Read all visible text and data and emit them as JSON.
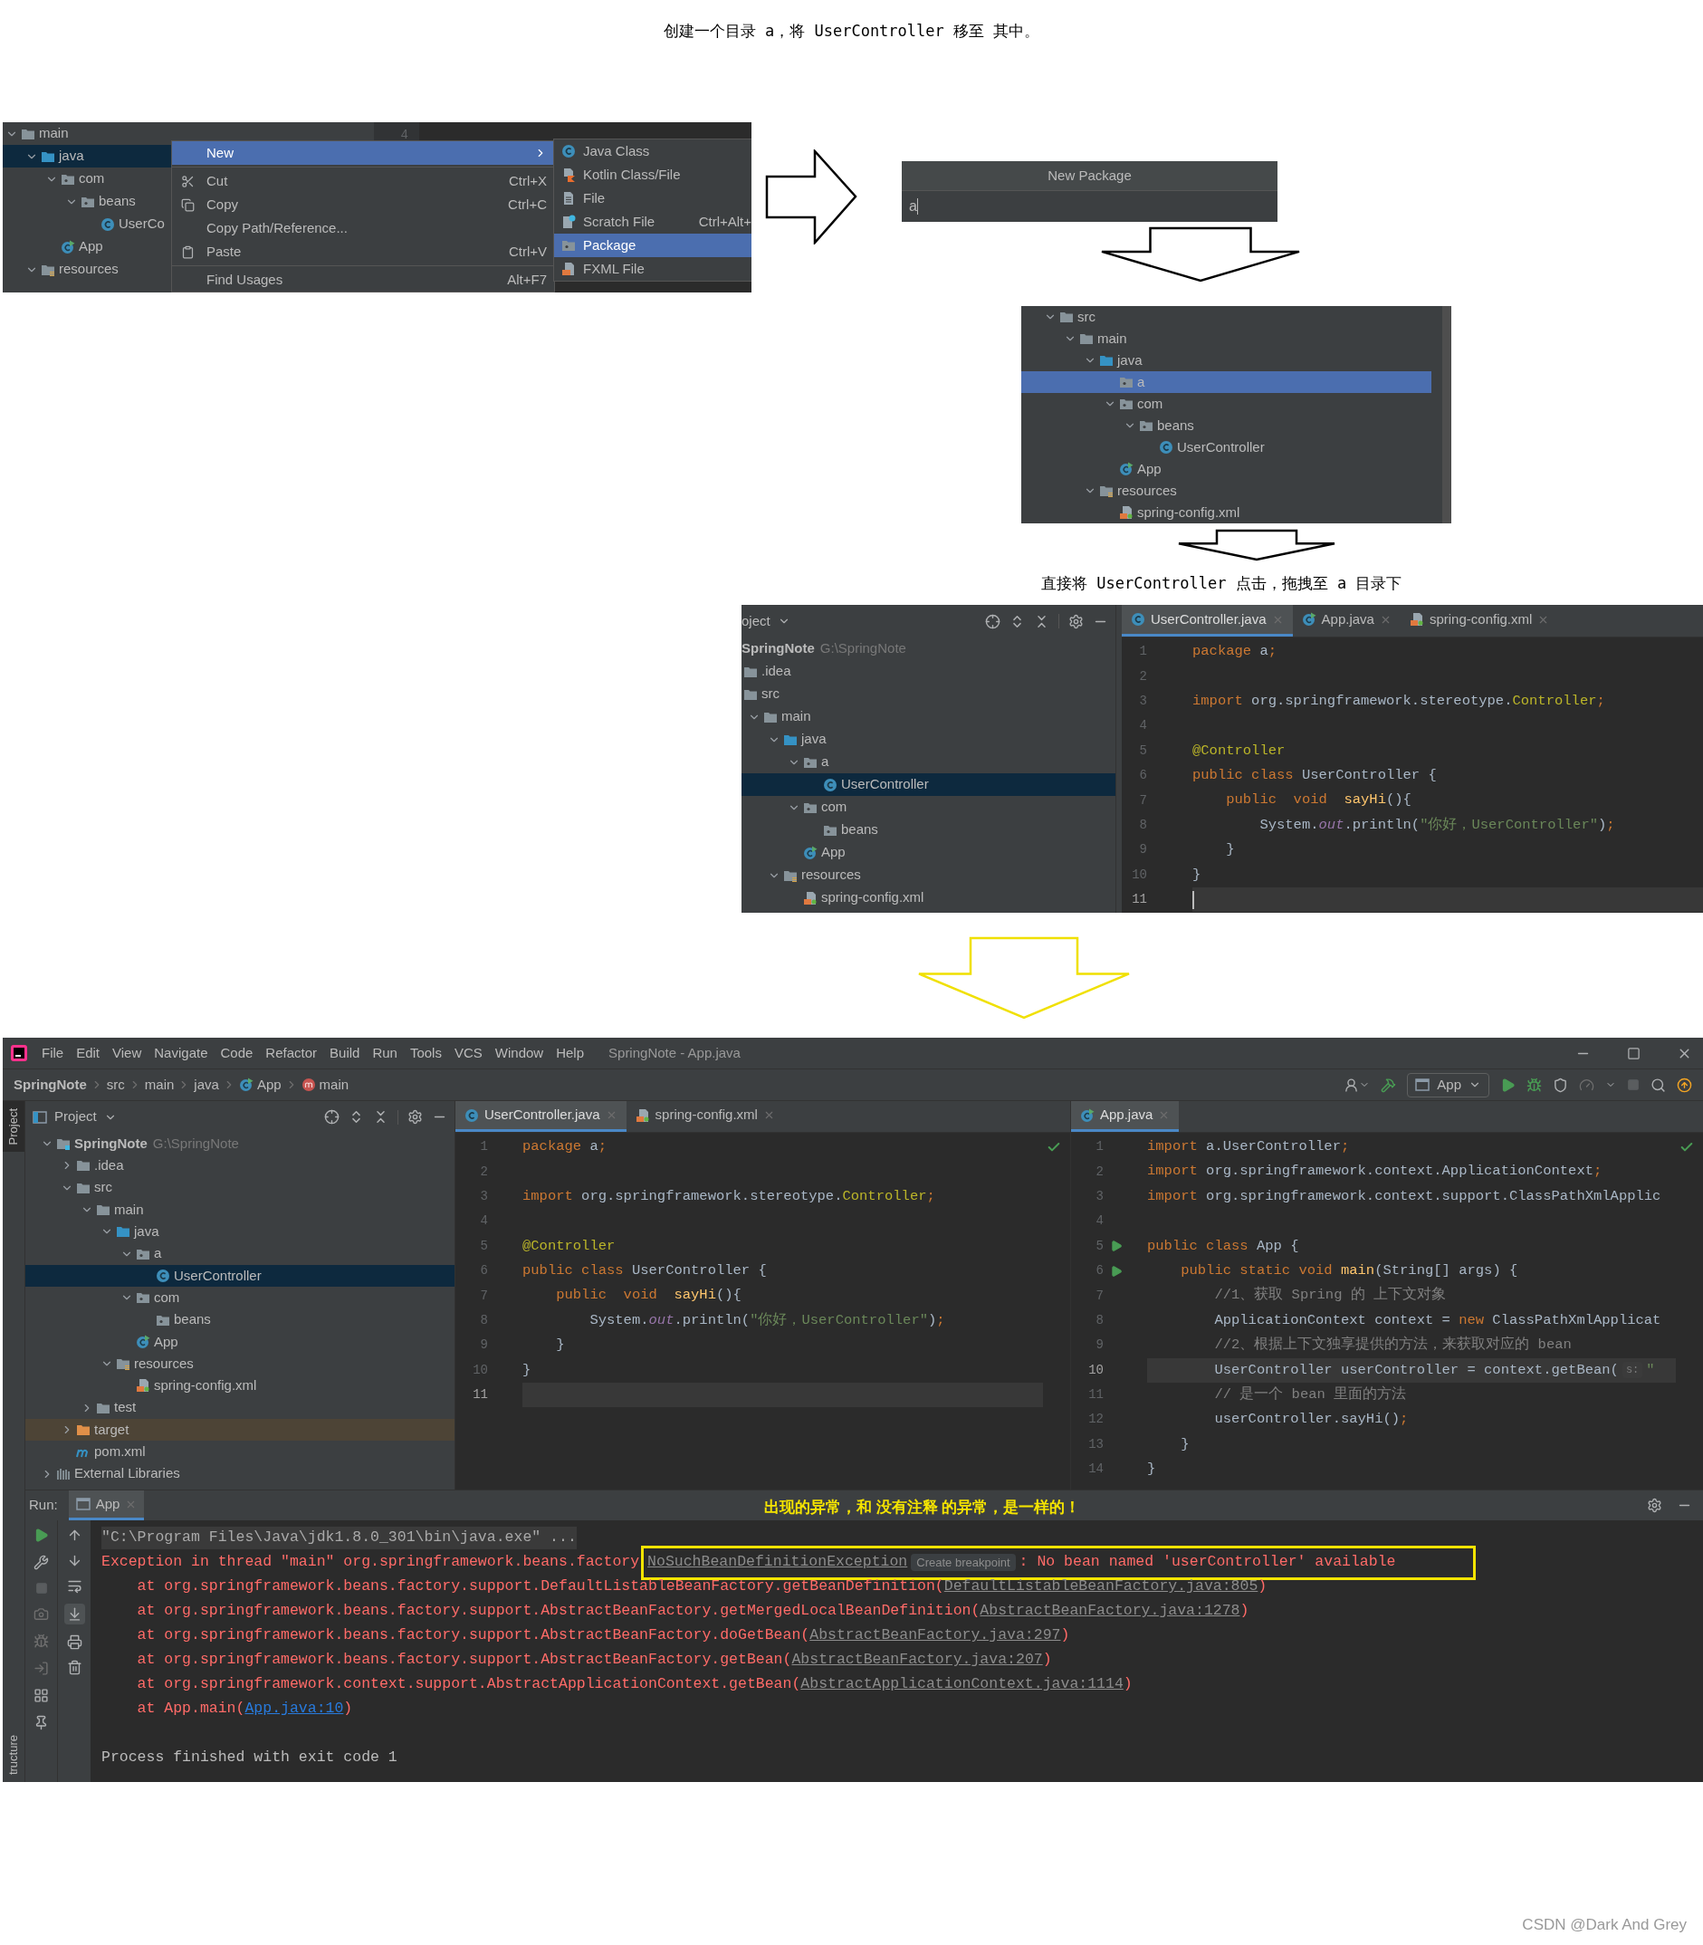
{
  "intro": "创建一个目录 a，将 UserController 移至 其中。",
  "step1": {
    "gutter_number": "4",
    "tree": [
      {
        "label": "main",
        "kind": "folder",
        "expanded": true,
        "selected": false,
        "children": [
          {
            "label": "java",
            "kind": "source-folder",
            "expanded": true,
            "selected": true,
            "children": [
              {
                "label": "com",
                "kind": "package",
                "expanded": true,
                "selected": false,
                "children": [
                  {
                    "label": "beans",
                    "kind": "package",
                    "expanded": true,
                    "selected": false,
                    "children": [
                      {
                        "label": "UserCo",
                        "kind": "class",
                        "selected": false
                      }
                    ]
                  }
                ]
              },
              {
                "label": "App",
                "kind": "app-class",
                "selected": false
              }
            ]
          },
          {
            "label": "resources",
            "kind": "resources-folder",
            "expanded": true,
            "selected": false
          }
        ]
      }
    ],
    "menu": [
      {
        "label": "New",
        "kind": "submenu",
        "selected": true
      },
      {
        "label": "Cut",
        "shortcut": "Ctrl+X",
        "kind": "action",
        "selected": false
      },
      {
        "label": "Copy",
        "shortcut": "Ctrl+C",
        "kind": "action",
        "selected": false
      },
      {
        "label": "Copy Path/Reference...",
        "kind": "action",
        "selected": false
      },
      {
        "label": "Paste",
        "shortcut": "Ctrl+V",
        "kind": "action",
        "selected": false
      },
      {
        "label": "Find Usages",
        "shortcut": "Alt+F7",
        "kind": "action",
        "selected": false
      }
    ],
    "submenu": [
      {
        "label": "Java Class",
        "selected": false
      },
      {
        "label": "Kotlin Class/File",
        "selected": false
      },
      {
        "label": "File",
        "selected": false
      },
      {
        "label": "Scratch File",
        "shortcut": "Ctrl+Alt+",
        "selected": false
      },
      {
        "label": "Package",
        "selected": true
      },
      {
        "label": "FXML File",
        "selected": false
      }
    ]
  },
  "dialog": {
    "title": "New Package",
    "value": "a"
  },
  "step2_tree": [
    {
      "label": "src",
      "kind": "folder",
      "expanded": true,
      "selected": false,
      "children": [
        {
          "label": "main",
          "kind": "folder",
          "expanded": true,
          "selected": false,
          "children": [
            {
              "label": "java",
              "kind": "source-folder",
              "expanded": true,
              "selected": false,
              "children": [
                {
                  "label": "a",
                  "kind": "package",
                  "selected": true
                },
                {
                  "label": "com",
                  "kind": "package",
                  "expanded": true,
                  "selected": false,
                  "children": [
                    {
                      "label": "beans",
                      "kind": "package",
                      "expanded": true,
                      "selected": false,
                      "children": [
                        {
                          "label": "UserController",
                          "kind": "class",
                          "selected": false
                        }
                      ]
                    }
                  ]
                },
                {
                  "label": "App",
                  "kind": "app-class",
                  "selected": false
                }
              ]
            },
            {
              "label": "resources",
              "kind": "resources-folder",
              "expanded": true,
              "selected": false,
              "children": [
                {
                  "label": "spring-config.xml",
                  "kind": "xml",
                  "selected": false
                }
              ]
            }
          ]
        }
      ]
    }
  ],
  "step2_caption": "直接将 UserController 点击，拖拽至 a 目录下",
  "step3": {
    "panel_title": "oject",
    "tree": [
      {
        "label": "SpringNote",
        "path": "G:\\SpringNote",
        "selected": false,
        "children": [
          {
            "label": ".idea",
            "kind": "folder",
            "selected": false
          },
          {
            "label": "src",
            "kind": "folder",
            "selected": false,
            "children": [
              {
                "label": "main",
                "kind": "folder",
                "expanded": true,
                "selected": false,
                "children": [
                  {
                    "label": "java",
                    "kind": "source-folder",
                    "expanded": true,
                    "selected": false,
                    "children": [
                      {
                        "label": "a",
                        "kind": "package",
                        "expanded": true,
                        "selected": false,
                        "children": [
                          {
                            "label": "UserController",
                            "kind": "class",
                            "selected": true
                          }
                        ]
                      },
                      {
                        "label": "com",
                        "kind": "package",
                        "expanded": true,
                        "selected": false,
                        "children": [
                          {
                            "label": "beans",
                            "kind": "package",
                            "selected": false
                          }
                        ]
                      },
                      {
                        "label": "App",
                        "kind": "app-class",
                        "selected": false
                      }
                    ]
                  },
                  {
                    "label": "resources",
                    "kind": "resources-folder",
                    "expanded": true,
                    "selected": false,
                    "children": [
                      {
                        "label": "spring-config.xml",
                        "kind": "xml",
                        "selected": false
                      }
                    ]
                  }
                ]
              }
            ]
          }
        ]
      }
    ],
    "tabs": [
      {
        "label": "UserController.java",
        "kind": "class",
        "selected": true
      },
      {
        "label": "App.java",
        "kind": "app-class",
        "selected": false
      },
      {
        "label": "spring-config.xml",
        "kind": "xml",
        "selected": false
      }
    ],
    "lines": [
      {
        "number": "1",
        "current": false,
        "tokens": [
          {
            "kind": "keyword",
            "text": "package"
          },
          {
            "kind": "plain",
            "text": " a"
          },
          {
            "kind": "keyword",
            "text": ";"
          }
        ]
      },
      {
        "number": "2",
        "current": false
      },
      {
        "number": "3",
        "current": false,
        "tokens": [
          {
            "kind": "keyword",
            "text": "import"
          },
          {
            "kind": "plain",
            "text": " org.springframework.stereotype."
          },
          {
            "kind": "annotation",
            "text": "Controller"
          },
          {
            "kind": "keyword",
            "text": ";"
          }
        ]
      },
      {
        "number": "4",
        "current": false
      },
      {
        "number": "5",
        "current": false,
        "tokens": [
          {
            "kind": "annotation",
            "text": "@Controller"
          }
        ]
      },
      {
        "number": "6",
        "current": false,
        "tokens": [
          {
            "kind": "keyword",
            "text": "public class"
          },
          {
            "kind": "plain",
            "text": " UserController {"
          }
        ]
      },
      {
        "number": "7",
        "current": false,
        "tokens": [
          {
            "kind": "keyword",
            "text": "    public  void  "
          },
          {
            "kind": "method",
            "text": "sayHi"
          },
          {
            "kind": "plain",
            "text": "(){"
          }
        ]
      },
      {
        "number": "8",
        "current": false,
        "tokens": [
          {
            "kind": "plain",
            "text": "        System."
          },
          {
            "kind": "field",
            "text": "out"
          },
          {
            "kind": "plain",
            "text": ".println("
          },
          {
            "kind": "string",
            "text": "\"你好，UserController\""
          },
          {
            "kind": "plain",
            "text": ")"
          },
          {
            "kind": "keyword",
            "text": ";"
          }
        ]
      },
      {
        "number": "9",
        "current": false,
        "tokens": [
          {
            "kind": "plain",
            "text": "    }"
          }
        ]
      },
      {
        "number": "10",
        "current": false,
        "tokens": [
          {
            "kind": "plain",
            "text": "}"
          }
        ]
      },
      {
        "number": "11",
        "current": true
      }
    ]
  },
  "ide": {
    "menu": [
      "File",
      "Edit",
      "View",
      "Navigate",
      "Code",
      "Refactor",
      "Build",
      "Run",
      "Tools",
      "VCS",
      "Window",
      "Help"
    ],
    "title": "SpringNote - App.java",
    "breadcrumbs": [
      {
        "label": "SpringNote",
        "kind": "project"
      },
      {
        "label": "src",
        "kind": "folder"
      },
      {
        "label": "main",
        "kind": "folder"
      },
      {
        "label": "java",
        "kind": "folder"
      },
      {
        "label": "App",
        "kind": "app-class"
      },
      {
        "label": "main",
        "kind": "method"
      }
    ],
    "run_config": "App",
    "side_tabs": [
      {
        "label": "Project",
        "selected": true
      },
      {
        "label": "tructure",
        "selected": false
      }
    ],
    "project": {
      "title": "Project",
      "tree": [
        {
          "label": "SpringNote",
          "path": "G:\\SpringNote",
          "kind": "module",
          "expanded": true,
          "selected": false,
          "children": [
            {
              "label": ".idea",
              "kind": "folder",
              "expanded": false,
              "selected": false
            },
            {
              "label": "src",
              "kind": "folder",
              "expanded": true,
              "selected": false,
              "children": [
                {
                  "label": "main",
                  "kind": "folder",
                  "expanded": true,
                  "selected": false,
                  "children": [
                    {
                      "label": "java",
                      "kind": "source-folder",
                      "expanded": true,
                      "selected": false,
                      "children": [
                        {
                          "label": "a",
                          "kind": "package",
                          "expanded": true,
                          "selected": false,
                          "children": [
                            {
                              "label": "UserController",
                              "kind": "class",
                              "selected": true
                            }
                          ]
                        },
                        {
                          "label": "com",
                          "kind": "package",
                          "expanded": true,
                          "selected": false,
                          "children": [
                            {
                              "label": "beans",
                              "kind": "package",
                              "selected": false
                            }
                          ]
                        },
                        {
                          "label": "App",
                          "kind": "app-class",
                          "selected": false
                        }
                      ]
                    },
                    {
                      "label": "resources",
                      "kind": "resources-folder",
                      "expanded": true,
                      "selected": false,
                      "children": [
                        {
                          "label": "spring-config.xml",
                          "kind": "xml",
                          "selected": false
                        }
                      ]
                    }
                  ]
                },
                {
                  "label": "test",
                  "kind": "folder",
                  "expanded": false,
                  "selected": false
                }
              ]
            },
            {
              "label": "target",
              "kind": "excluded-folder",
              "expanded": false,
              "selected": false
            },
            {
              "label": "pom.xml",
              "kind": "maven",
              "selected": false
            }
          ]
        },
        {
          "label": "External Libraries",
          "kind": "libraries",
          "expanded": false,
          "selected": false
        }
      ]
    },
    "editors": [
      {
        "tabs": [
          {
            "label": "UserController.java",
            "kind": "class",
            "selected": true
          },
          {
            "label": "spring-config.xml",
            "kind": "xml",
            "selected": false
          }
        ],
        "lines": [
          {
            "number": "1",
            "current": false,
            "tokens": [
              {
                "kind": "keyword",
                "text": "package"
              },
              {
                "kind": "plain",
                "text": " a"
              },
              {
                "kind": "keyword",
                "text": ";"
              }
            ]
          },
          {
            "number": "2",
            "current": false
          },
          {
            "number": "3",
            "current": false,
            "tokens": [
              {
                "kind": "keyword",
                "text": "import"
              },
              {
                "kind": "plain",
                "text": " org.springframework.stereotype."
              },
              {
                "kind": "annotation",
                "text": "Controller"
              },
              {
                "kind": "keyword",
                "text": ";"
              }
            ]
          },
          {
            "number": "4",
            "current": false
          },
          {
            "number": "5",
            "current": false,
            "tokens": [
              {
                "kind": "annotation",
                "text": "@Controller"
              }
            ]
          },
          {
            "number": "6",
            "current": false,
            "tokens": [
              {
                "kind": "keyword",
                "text": "public class"
              },
              {
                "kind": "plain",
                "text": " UserController {"
              }
            ]
          },
          {
            "number": "7",
            "current": false,
            "tokens": [
              {
                "kind": "keyword",
                "text": "    public  void  "
              },
              {
                "kind": "method",
                "text": "sayHi"
              },
              {
                "kind": "plain",
                "text": "(){"
              }
            ]
          },
          {
            "number": "8",
            "current": false,
            "tokens": [
              {
                "kind": "plain",
                "text": "        System."
              },
              {
                "kind": "field",
                "text": "out"
              },
              {
                "kind": "plain",
                "text": ".println("
              },
              {
                "kind": "string",
                "text": "\"你好，UserController\""
              },
              {
                "kind": "plain",
                "text": ")"
              },
              {
                "kind": "keyword",
                "text": ";"
              }
            ]
          },
          {
            "number": "9",
            "current": false,
            "tokens": [
              {
                "kind": "plain",
                "text": "    }"
              }
            ]
          },
          {
            "number": "10",
            "current": false,
            "tokens": [
              {
                "kind": "plain",
                "text": "}"
              }
            ]
          },
          {
            "number": "11",
            "current": true
          }
        ]
      },
      {
        "tabs": [
          {
            "label": "App.java",
            "kind": "app-class",
            "selected": true
          }
        ],
        "lines": [
          {
            "number": "1",
            "current": false,
            "run_icon": false,
            "tokens": [
              {
                "kind": "keyword",
                "text": "import"
              },
              {
                "kind": "plain",
                "text": " a.UserController"
              },
              {
                "kind": "keyword",
                "text": ";"
              }
            ]
          },
          {
            "number": "2",
            "current": false,
            "run_icon": false,
            "tokens": [
              {
                "kind": "keyword",
                "text": "import"
              },
              {
                "kind": "plain",
                "text": " org.springframework.context.ApplicationContext"
              },
              {
                "kind": "keyword",
                "text": ";"
              }
            ]
          },
          {
            "number": "3",
            "current": false,
            "run_icon": false,
            "tokens": [
              {
                "kind": "keyword",
                "text": "import"
              },
              {
                "kind": "plain",
                "text": " org.springframework.context.support.ClassPathXmlApplic"
              }
            ]
          },
          {
            "number": "4",
            "current": false,
            "run_icon": false
          },
          {
            "number": "5",
            "current": false,
            "run_icon": true,
            "tokens": [
              {
                "kind": "keyword",
                "text": "public class"
              },
              {
                "kind": "plain",
                "text": " App {"
              }
            ]
          },
          {
            "number": "6",
            "current": false,
            "run_icon": true,
            "tokens": [
              {
                "kind": "keyword",
                "text": "    public static void "
              },
              {
                "kind": "method",
                "text": "main"
              },
              {
                "kind": "plain",
                "text": "(String[] args) {"
              }
            ]
          },
          {
            "number": "7",
            "current": false,
            "run_icon": false,
            "tokens": [
              {
                "kind": "comment",
                "text": "        //1、获取 Spring 的 上下文对象"
              }
            ]
          },
          {
            "number": "8",
            "current": false,
            "run_icon": false,
            "tokens": [
              {
                "kind": "plain",
                "text": "        ApplicationContext context = "
              },
              {
                "kind": "keyword",
                "text": "new"
              },
              {
                "kind": "plain",
                "text": " ClassPathXmlApplicat"
              }
            ]
          },
          {
            "number": "9",
            "current": false,
            "run_icon": false,
            "tokens": [
              {
                "kind": "comment",
                "text": "        //2、根据上下文独享提供的方法，来获取对应的 bean"
              }
            ]
          },
          {
            "number": "10",
            "current": true,
            "run_icon": false,
            "tokens": [
              {
                "kind": "plain",
                "text": "        UserController userController = context.getBean("
              },
              {
                "kind": "hint",
                "text": "s:"
              },
              {
                "kind": "string",
                "text": "\""
              }
            ]
          },
          {
            "number": "11",
            "current": false,
            "run_icon": false,
            "tokens": [
              {
                "kind": "comment",
                "text": "        // 是一个 bean 里面的方法"
              }
            ]
          },
          {
            "number": "12",
            "current": false,
            "run_icon": false,
            "tokens": [
              {
                "kind": "plain",
                "text": "        userController.sayHi()"
              },
              {
                "kind": "keyword",
                "text": ";"
              }
            ]
          },
          {
            "number": "13",
            "current": false,
            "run_icon": false,
            "tokens": [
              {
                "kind": "plain",
                "text": "    }"
              }
            ]
          },
          {
            "number": "14",
            "current": false,
            "run_icon": false,
            "tokens": [
              {
                "kind": "plain",
                "text": "}"
              }
            ]
          }
        ]
      }
    ],
    "run": {
      "label": "Run:",
      "tab": "App",
      "annotation": "出现的异常，和 没有注释 的异常，是一样的！",
      "console": [
        {
          "segments": [
            {
              "kind": "command",
              "text": "\"C:\\Program Files\\Java\\jdk1.8.0_301\\bin\\java.exe\" ..."
            }
          ]
        },
        {
          "segments": [
            {
              "kind": "error",
              "text": "Exception in thread \"main\" org.springframework.beans.factory"
            },
            {
              "kind": "link",
              "text": "NoSuchBeanDefinitionException"
            },
            {
              "kind": "hint",
              "text": "Create breakpoint"
            },
            {
              "kind": "error",
              "text": ": No bean named 'userController' available"
            }
          ]
        },
        {
          "segments": [
            {
              "kind": "error",
              "text": "    at org.springframework.beans.factory.support.DefaultListableBeanFactory.getBeanDefinition("
            },
            {
              "kind": "link",
              "text": "DefaultListableBeanFactory.java:805"
            },
            {
              "kind": "error",
              "text": ")"
            }
          ]
        },
        {
          "segments": [
            {
              "kind": "error",
              "text": "    at org.springframework.beans.factory.support.AbstractBeanFactory.getMergedLocalBeanDefinition("
            },
            {
              "kind": "link",
              "text": "AbstractBeanFactory.java:1278"
            },
            {
              "kind": "error",
              "text": ")"
            }
          ]
        },
        {
          "segments": [
            {
              "kind": "error",
              "text": "    at org.springframework.beans.factory.support.AbstractBeanFactory.doGetBean("
            },
            {
              "kind": "link",
              "text": "AbstractBeanFactory.java:297"
            },
            {
              "kind": "error",
              "text": ")"
            }
          ]
        },
        {
          "segments": [
            {
              "kind": "error",
              "text": "    at org.springframework.beans.factory.support.AbstractBeanFactory.getBean("
            },
            {
              "kind": "link",
              "text": "AbstractBeanFactory.java:207"
            },
            {
              "kind": "error",
              "text": ")"
            }
          ]
        },
        {
          "segments": [
            {
              "kind": "error",
              "text": "    at org.springframework.context.support.AbstractApplicationContext.getBean("
            },
            {
              "kind": "link",
              "text": "AbstractApplicationContext.java:1114"
            },
            {
              "kind": "error",
              "text": ")"
            }
          ]
        },
        {
          "segments": [
            {
              "kind": "error",
              "text": "    at App.main("
            },
            {
              "kind": "source-link",
              "text": "App.java:10"
            },
            {
              "kind": "error",
              "text": ")"
            }
          ]
        }
      ],
      "exit_message": "Process finished with exit code 1"
    }
  },
  "footer": "CSDN @Dark And Grey"
}
